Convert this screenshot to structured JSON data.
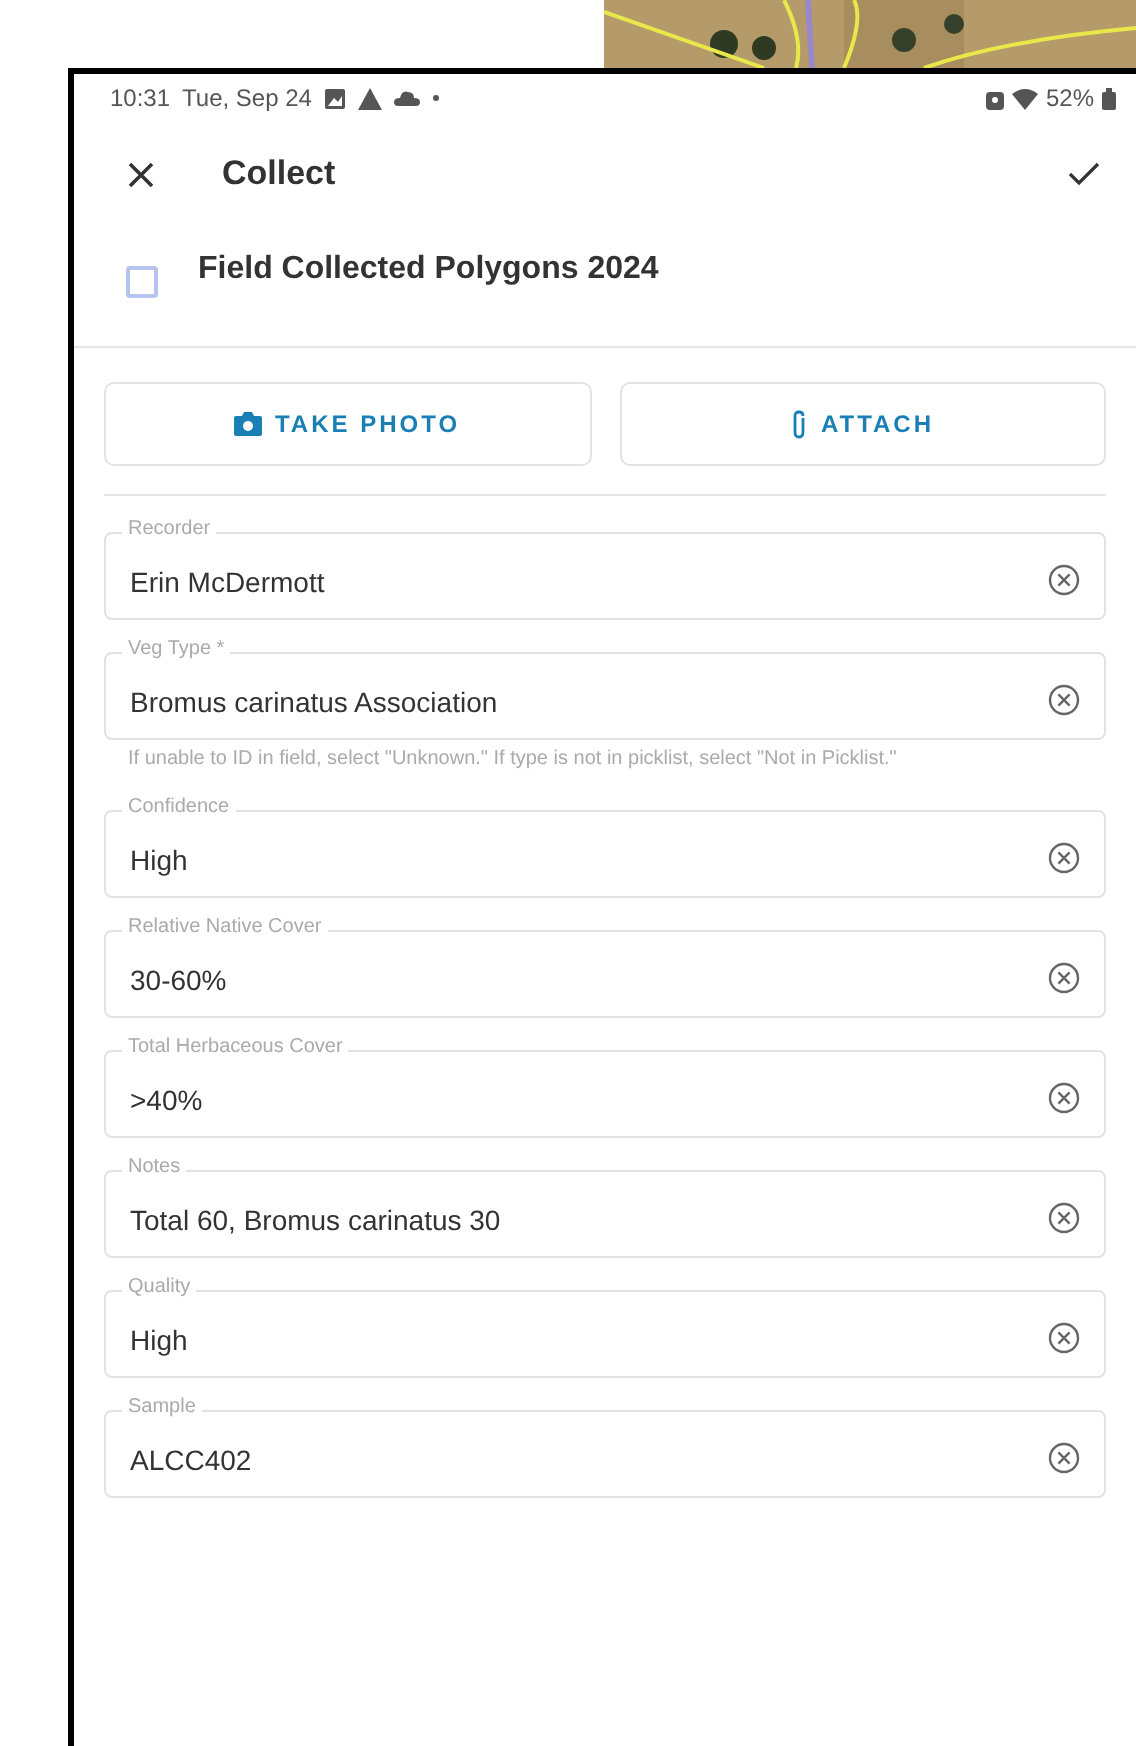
{
  "status_bar": {
    "time": "10:31",
    "date": "Tue, Sep 24",
    "battery": "52%"
  },
  "header": {
    "title": "Collect"
  },
  "layer": {
    "name": "Field Collected Polygons 2024",
    "checked": false
  },
  "buttons": [
    {
      "label": "TAKE PHOTO",
      "kind": "camera"
    },
    {
      "label": "ATTACH",
      "kind": "clip"
    }
  ],
  "fields": [
    {
      "label": "Recorder",
      "value": "Erin McDermott"
    },
    {
      "label": "Veg Type *",
      "value": "Bromus carinatus Association",
      "hint": "If unable to ID in field, select \"Unknown.\" If type is not in picklist, select \"Not in Picklist.\""
    },
    {
      "label": "Confidence",
      "value": "High"
    },
    {
      "label": "Relative Native Cover",
      "value": "30-60%"
    },
    {
      "label": "Total Herbaceous Cover",
      "value": ">40%"
    },
    {
      "label": "Notes",
      "value": "Total 60, Bromus carinatus 30"
    },
    {
      "label": "Quality",
      "value": "High"
    },
    {
      "label": "Sample",
      "value": "ALCC402"
    }
  ]
}
